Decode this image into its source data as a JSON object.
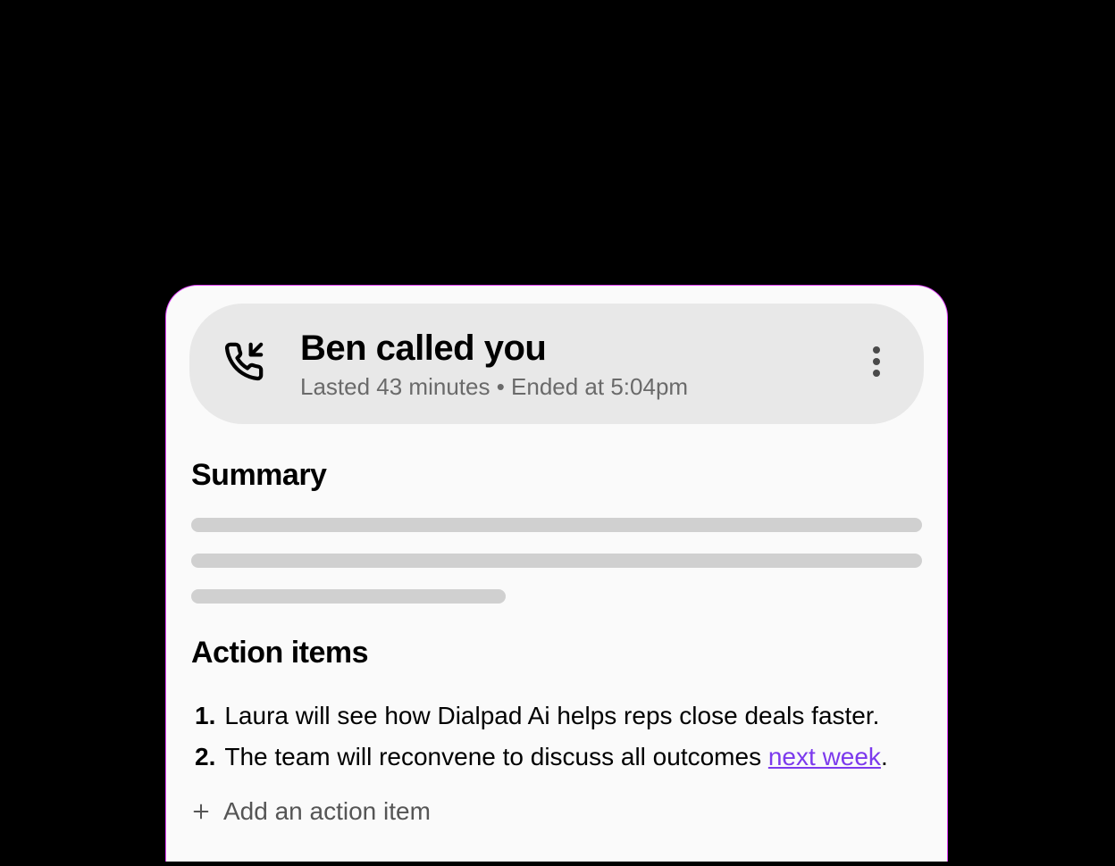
{
  "header": {
    "title": "Ben called you",
    "duration_text": "Lasted 43 minutes",
    "separator": " • ",
    "ended_text": "Ended at 5:04pm"
  },
  "summary": {
    "heading": "Summary"
  },
  "action_items": {
    "heading": "Action items",
    "items": [
      {
        "number": "1.",
        "text_before": "Laura will see how Dialpad Ai helps reps close deals faster.",
        "link_text": "",
        "text_after": ""
      },
      {
        "number": "2.",
        "text_before": "The team will reconvene to discuss all outcomes ",
        "link_text": "next week",
        "text_after": "."
      }
    ],
    "add_label": "Add an action item"
  }
}
